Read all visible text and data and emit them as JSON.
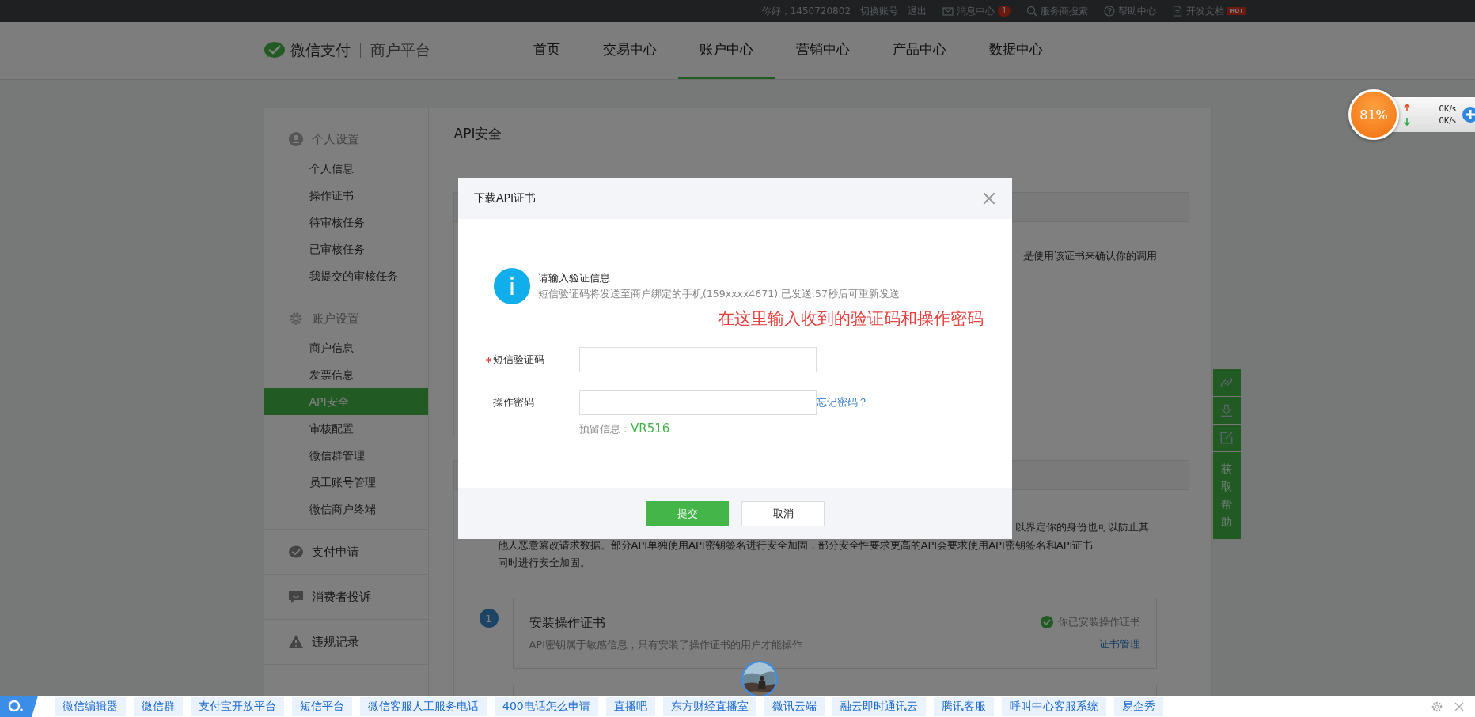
{
  "top_bar": {
    "items": [
      {
        "kind": "text",
        "label": "你好，1450720802"
      },
      {
        "kind": "link",
        "label": "切换账号"
      },
      {
        "kind": "link",
        "label": "退出"
      },
      {
        "kind": "mail",
        "label": "消息中心",
        "badge": "1"
      },
      {
        "kind": "search",
        "label": "服务商搜索"
      },
      {
        "kind": "help",
        "label": "帮助中心"
      },
      {
        "kind": "doc",
        "label": "开发文档",
        "badge": "HOT"
      }
    ]
  },
  "header": {
    "logo_name": "微信支付",
    "logo_sub": "商户平台",
    "nav": [
      {
        "label": "首页",
        "selected": false
      },
      {
        "label": "交易中心",
        "selected": false
      },
      {
        "label": "账户中心",
        "selected": true
      },
      {
        "label": "营销中心",
        "selected": false
      },
      {
        "label": "产品中心",
        "selected": false
      },
      {
        "label": "数据中心",
        "selected": false
      }
    ]
  },
  "sidebar": {
    "groups": [
      {
        "kind": "person",
        "title": "个人设置",
        "items": [
          {
            "label": "个人信息",
            "selected": false
          },
          {
            "label": "操作证书",
            "selected": false
          },
          {
            "label": "待审核任务",
            "selected": false
          },
          {
            "label": "已审核任务",
            "selected": false
          },
          {
            "label": "我提交的审核任务",
            "selected": false
          }
        ]
      },
      {
        "kind": "gear",
        "title": "账户设置",
        "items": [
          {
            "label": "商户信息",
            "selected": false
          },
          {
            "label": "发票信息",
            "selected": false
          },
          {
            "label": "API安全",
            "selected": true
          },
          {
            "label": "审核配置",
            "selected": false
          },
          {
            "label": "微信群管理",
            "selected": false
          },
          {
            "label": "员工账号管理",
            "selected": false
          },
          {
            "label": "微信商户终端",
            "selected": false
          }
        ]
      },
      {
        "kind": "pay",
        "title": "支付申请"
      },
      {
        "kind": "chat",
        "title": "消费者投诉"
      },
      {
        "kind": "warning",
        "title": "违规记录"
      }
    ]
  },
  "content": {
    "title": "API安全",
    "card1_fragment": "是使用该证书来确认你的调用",
    "intro_fragment": "以界定你的身份也可以防止其",
    "intro_lines": [
      "他人恶意篡改请求数据。部分API单独使用API密钥签名进行安全加固，部分安全性要求更高的API会要求使用API密钥签名和API证书",
      "同时进行安全加固。"
    ],
    "steps": [
      {
        "number": "1",
        "title": "安装操作证书",
        "description": "API密钥属于敏感信息，只有安装了操作证书的用户才能操作",
        "status": "你已安装操作证书",
        "link": "证书管理"
      }
    ]
  },
  "help_toolbar": {
    "label": "获取帮助"
  },
  "modal": {
    "title": "下载API证书",
    "info_title": "请输入验证信息",
    "info_text": "短信验证码将发送至商户绑定的手机(159xxxx4671) 已发送,57秒后可重新发送",
    "annotation": "在这里输入收到的验证码和操作密码",
    "fields": [
      {
        "label": "短信验证码",
        "required": true
      },
      {
        "label": "操作密码",
        "required": false,
        "link": "忘记密码？"
      }
    ],
    "reserved_label": "预留信息：",
    "reserved_value": "VR516",
    "buttons": [
      {
        "label": "提交",
        "kind": "primary"
      },
      {
        "label": "取消",
        "kind": "default"
      }
    ]
  },
  "speed_widget": {
    "percent": "81%",
    "upload": "0K/s",
    "download": "0K/s"
  },
  "bottom_bar": {
    "links": [
      "微信编辑器",
      "微信群",
      "支付宝开放平台",
      "短信平台",
      "微信客服人工服务电话",
      "400电话怎么申请",
      "直播吧",
      "东方财经直播室",
      "微讯云端",
      "融云即时通讯云",
      "腾讯客服",
      "呼叫中心客服系统",
      "易企秀"
    ]
  }
}
